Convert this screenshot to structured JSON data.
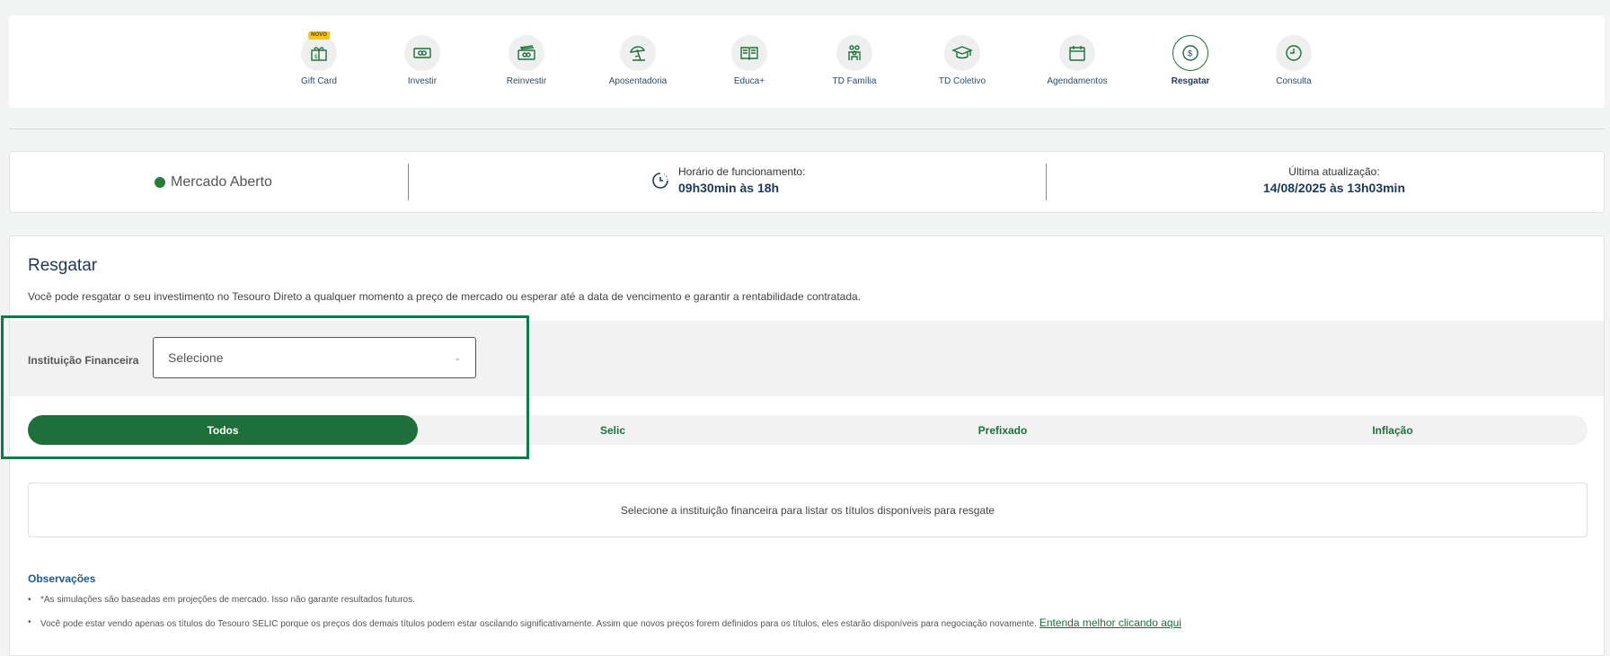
{
  "nav": {
    "items": [
      {
        "label": "Gift Card",
        "icon": "gift-icon",
        "badge": "NOVO"
      },
      {
        "label": "Investir",
        "icon": "money-bill-icon"
      },
      {
        "label": "Reinvestir",
        "icon": "money-stack-icon"
      },
      {
        "label": "Aposentadoria",
        "icon": "beach-umbrella-icon"
      },
      {
        "label": "Educa+",
        "icon": "open-book-icon"
      },
      {
        "label": "TD Família",
        "icon": "family-icon"
      },
      {
        "label": "TD Coletivo",
        "icon": "graduation-cap-icon"
      },
      {
        "label": "Agendamentos",
        "icon": "calendar-icon"
      },
      {
        "label": "Resgatar",
        "icon": "dollar-circle-icon",
        "active": true
      },
      {
        "label": "Consulta",
        "icon": "clock-icon"
      }
    ]
  },
  "status": {
    "market": "Mercado Aberto",
    "market_color": "#2a7a3a",
    "hours_label": "Horário de funcionamento:",
    "hours_value": "09h30min às 18h",
    "update_label": "Última atualização:",
    "update_value": "14/08/2025 às 13h03min"
  },
  "main": {
    "title": "Resgatar",
    "description": "Você pode resgatar o seu investimento no Tesouro Direto a qualquer momento a preço de mercado ou esperar até a data de vencimento e garantir a rentabilidade contratada.",
    "institution_label": "Instituição Financeira",
    "institution_select": "Selecione",
    "tabs": [
      {
        "label": "Todos",
        "active": true
      },
      {
        "label": "Selic"
      },
      {
        "label": "Prefixado"
      },
      {
        "label": "Inflação"
      }
    ],
    "empty_message": "Selecione a instituição financeira para listar os títulos disponíveis para resgate"
  },
  "observations": {
    "title": "Observações",
    "items": [
      "*As simulações são baseadas em projeções de mercado. Isso não garante resultados futuros.",
      "Você pode estar vendo apenas os títulos do Tesouro SELIC porque os preços dos demais títulos podem estar oscilando significativamente. Assim que novos preços forem definidos para os títulos, eles estarão disponíveis para negociação novamente."
    ],
    "link": "Entenda melhor clicando aqui"
  },
  "colors": {
    "primary_green": "#1e6f3a",
    "navy": "#1c3a57",
    "highlight": "#0c7a4a"
  }
}
